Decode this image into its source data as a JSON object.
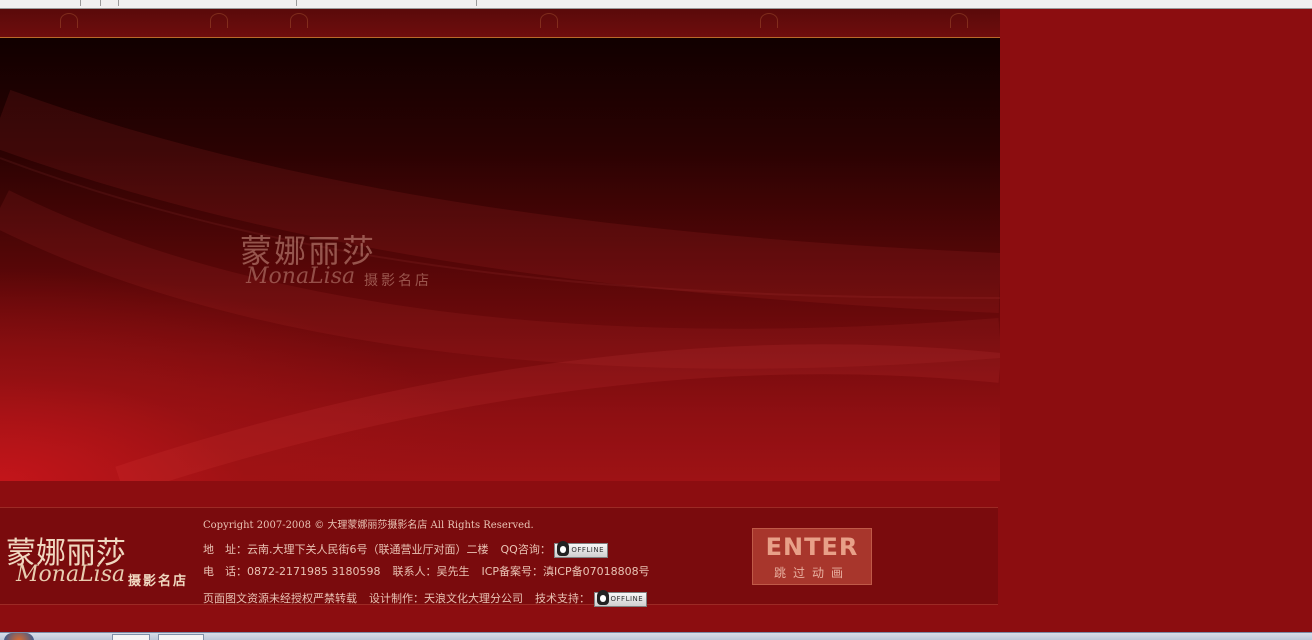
{
  "hero": {
    "logo_cn": "蒙娜丽莎",
    "logo_script": "MonaLisa",
    "logo_sub": "摄影名店"
  },
  "footer": {
    "logo_cn": "蒙娜丽莎",
    "logo_script": "MonaLisa",
    "logo_sub": "摄影名店",
    "copyright": "Copyright 2007-2008 © 大理蒙娜丽莎摄影名店 All Rights Reserved.",
    "address_label": "地　址：",
    "address": "云南.大理下关人民街6号（联通营业厅对面）二楼",
    "qq_label": "QQ咨询：",
    "qq_status": "OFFLINE",
    "phone_label": "电　话：",
    "phone": "0872-2171985 3180598",
    "contact_label": "联系人：",
    "contact": "吴先生",
    "icp_label": "ICP备案号：",
    "icp": "滇ICP备07018808号",
    "notice": "页面图文资源未经授权严禁转载",
    "design_label": "设计制作：",
    "design": "天浪文化大理分公司",
    "support_label": "技术支持：",
    "support_status": "OFFLINE"
  },
  "enter": {
    "label": "ENTER",
    "sub_label": "跳过动画"
  }
}
